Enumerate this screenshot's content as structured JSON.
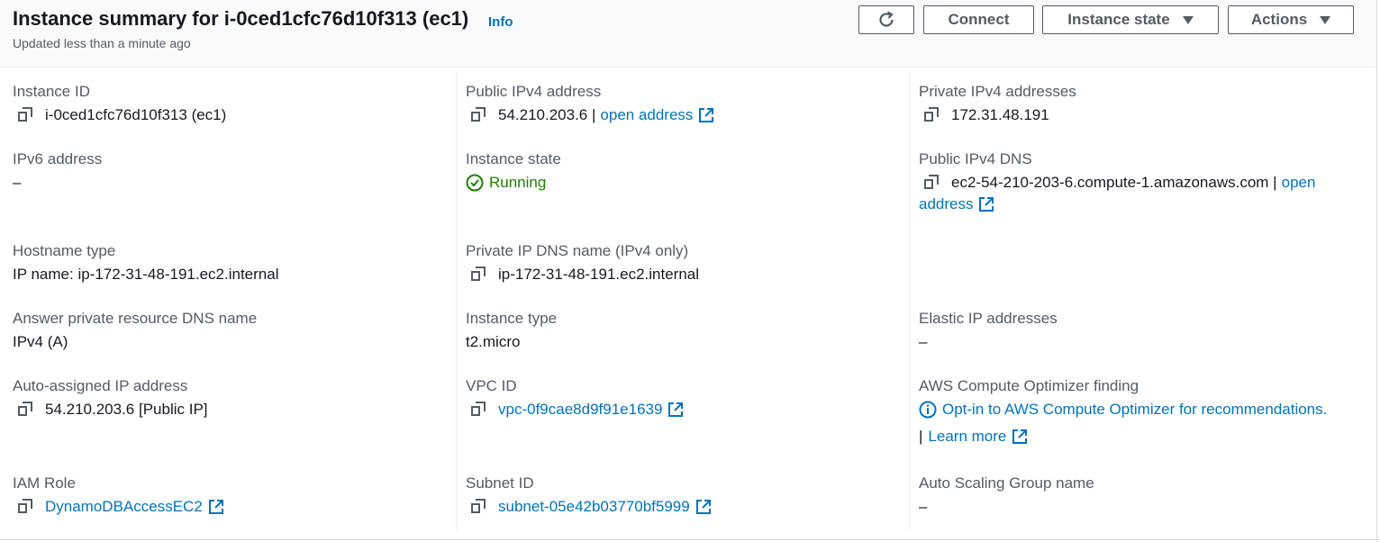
{
  "header": {
    "title": "Instance summary for i-0ced1cfc76d10f313 (ec1)",
    "info": "Info",
    "subtitle": "Updated less than a minute ago",
    "buttons": {
      "connect": "Connect",
      "instance_state": "Instance state",
      "actions": "Actions"
    }
  },
  "fields": {
    "instance_id": {
      "label": "Instance ID",
      "value": "i-0ced1cfc76d10f313 (ec1)"
    },
    "ipv6": {
      "label": "IPv6 address",
      "value": "–"
    },
    "hostname_type": {
      "label": "Hostname type",
      "value": "IP name: ip-172-31-48-191.ec2.internal"
    },
    "answer_dns": {
      "label": "Answer private resource DNS name",
      "value": "IPv4 (A)"
    },
    "auto_ip": {
      "label": "Auto-assigned IP address",
      "value": "54.210.203.6 [Public IP]"
    },
    "iam_role": {
      "label": "IAM Role",
      "value": "DynamoDBAccessEC2"
    },
    "public_ipv4": {
      "label": "Public IPv4 address",
      "value": "54.210.203.6 |",
      "link": "open address"
    },
    "instance_state": {
      "label": "Instance state",
      "value": "Running"
    },
    "private_ip_dns": {
      "label": "Private IP DNS name (IPv4 only)",
      "value": "ip-172-31-48-191.ec2.internal"
    },
    "instance_type": {
      "label": "Instance type",
      "value": "t2.micro"
    },
    "vpc_id": {
      "label": "VPC ID",
      "value": "vpc-0f9cae8d9f91e1639"
    },
    "subnet_id": {
      "label": "Subnet ID",
      "value": "subnet-05e42b03770bf5999"
    },
    "private_ipv4": {
      "label": "Private IPv4 addresses",
      "value": "172.31.48.191"
    },
    "public_dns": {
      "label": "Public IPv4 DNS",
      "value": "ec2-54-210-203-6.compute-1.amazonaws.com |",
      "link1": "open",
      "link2": "address"
    },
    "elastic_ip": {
      "label": "Elastic IP addresses",
      "value": "–"
    },
    "optimizer": {
      "label": "AWS Compute Optimizer finding",
      "value": "Opt-in to AWS Compute Optimizer for recommendations.",
      "sep": "|",
      "learn_more": "Learn more"
    },
    "asg": {
      "label": "Auto Scaling Group name",
      "value": "–"
    }
  },
  "colors": {
    "link": "#0073bb",
    "running": "#1d8102",
    "label": "#545b64"
  }
}
